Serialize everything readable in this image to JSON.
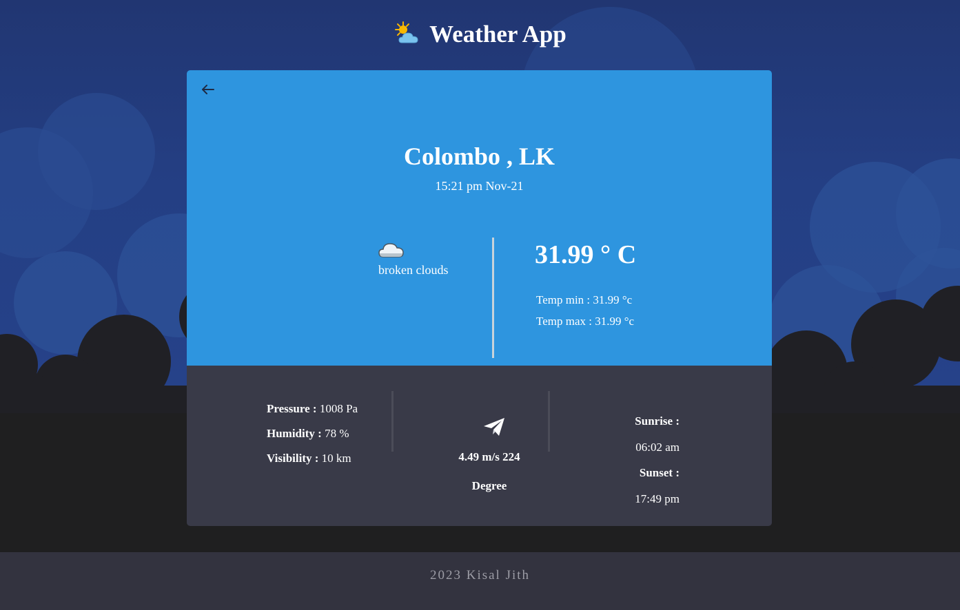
{
  "header": {
    "title": "Weather App",
    "logo_icon": "sun-behind-cloud-icon"
  },
  "weather_card": {
    "back_icon": "arrow-left-icon",
    "city": "Colombo , LK",
    "datetime": "15:21 pm Nov-21",
    "condition_icon": "cloud-icon",
    "condition": "broken clouds",
    "temperature": "31.99 ° C",
    "temp_min": "Temp min : 31.99 °c",
    "temp_max": "Temp max : 31.99 °c"
  },
  "details": {
    "pressure_label": "Pressure :",
    "pressure_value": "1008 Pa",
    "humidity_label": "Humidity :",
    "humidity_value": "78 %",
    "visibility_label": "Visibility :",
    "visibility_value": "10 km",
    "wind_icon": "paper-plane-icon",
    "wind_speed": "4.49 m/s 224",
    "wind_degree": "Degree",
    "sunrise_label": "Sunrise :",
    "sunrise_time": "06:02 am",
    "sunset_label": "Sunset :",
    "sunset_time": "17:49 pm"
  },
  "footer": {
    "text": "2023 Kisal Jith"
  },
  "colors": {
    "sky": "#243f84",
    "card_top": "#2e95df",
    "card_bottom": "#393a48",
    "footer": "#33333f"
  }
}
